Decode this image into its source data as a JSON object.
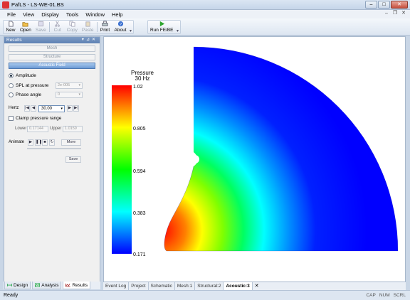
{
  "window": {
    "title": "PafLS - LS-WE-01.BS",
    "controls": [
      "minimize-icon",
      "maximize-icon",
      "close-icon"
    ]
  },
  "menu": [
    "File",
    "View",
    "Display",
    "Tools",
    "Window",
    "Help"
  ],
  "toolbar": {
    "buttons": [
      {
        "label": "New",
        "icon": "new-icon",
        "enabled": true
      },
      {
        "label": "Open",
        "icon": "open-icon",
        "enabled": true
      },
      {
        "label": "Save",
        "icon": "save-icon",
        "enabled": false
      },
      {
        "label": "Cut",
        "icon": "cut-icon",
        "enabled": false
      },
      {
        "label": "Copy",
        "icon": "copy-icon",
        "enabled": false
      },
      {
        "label": "Paste",
        "icon": "paste-icon",
        "enabled": false
      },
      {
        "label": "Print",
        "icon": "print-icon",
        "enabled": true
      },
      {
        "label": "About",
        "icon": "about-icon",
        "enabled": true
      }
    ],
    "run_label": "Run FE/BE"
  },
  "results_panel": {
    "title": "Results",
    "sections": [
      "Mesh",
      "Structure",
      "Acoustic Field"
    ],
    "amplitude_label": "Amplitude",
    "spl_label": "SPL at pressure",
    "spl_value": "2e-005",
    "phase_label": "Phase angle",
    "phase_value": "0",
    "hertz_label": "Hertz",
    "hertz_value": "30.00",
    "clamp_label": "Clamp pressure range",
    "lower_label": "Lower",
    "lower_value": "0.17144",
    "upper_label": "Upper",
    "upper_value": "1.0159",
    "animate_label": "Animate",
    "more_label": "More",
    "save_label": "Save"
  },
  "left_tabs": [
    "Design",
    "Analysis",
    "Results"
  ],
  "colorbar": {
    "title_line1": "Pressure",
    "title_line2": "30 Hz",
    "ticks": [
      "1.02",
      "0.805",
      "0.594",
      "0.383",
      "0.171"
    ]
  },
  "plot": {
    "min_value": 0.171,
    "max_value": 1.02
  },
  "doc_tabs": [
    "Event Log",
    "Project",
    "Schematic",
    "Mesh:1",
    "Structural:2",
    "Acoustic:3"
  ],
  "status": {
    "left": "Ready",
    "indicators": [
      "CAP",
      "NUM",
      "SCRL"
    ]
  }
}
